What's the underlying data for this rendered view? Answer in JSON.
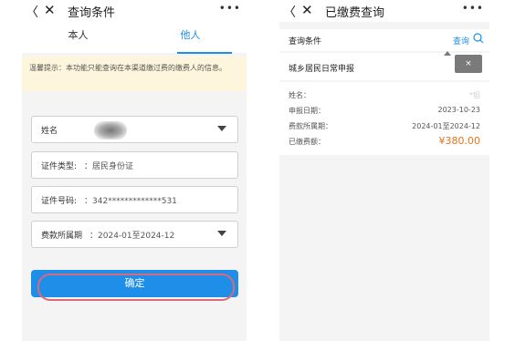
{
  "left": {
    "nav": {
      "back": "〈",
      "close": "✕",
      "title": "查询条件",
      "more": "•••"
    },
    "tabs": [
      {
        "label": "本人",
        "active": false
      },
      {
        "label": "他人",
        "active": true
      }
    ],
    "notice": "温馨提示：本功能只能查询在本渠道缴过费的缴费人的信息。",
    "fields": {
      "name": {
        "label": "姓名"
      },
      "id_type": {
        "label": "证件类型:",
        "value": "：居民身份证"
      },
      "id_number": {
        "label": "证件号码:",
        "value": "：342*************531"
      },
      "period": {
        "label": "费款所属期",
        "value": "：2024-01至2024-12"
      }
    },
    "confirm_label": "确定"
  },
  "right": {
    "nav": {
      "back": "〈",
      "close": "✕",
      "title": "已缴费查询",
      "more": "•••"
    },
    "criteria_label": "查询条件",
    "query_link": "查询",
    "record_type": "城乡居民日常申报",
    "tooltip_close": "×",
    "details": [
      {
        "key": "姓名：",
        "value": "*坦"
      },
      {
        "key": "申报日期：",
        "value": "2023-10-23"
      },
      {
        "key": "费款所属期：",
        "value": "2024-01至2024-12"
      },
      {
        "key": "已缴费额：",
        "value": "¥380.00"
      }
    ]
  },
  "colors": {
    "accent": "#1f8ee8",
    "amount": "#e8741e",
    "highlight_ring": "#d96a7a",
    "notice_bg": "#fdf6dd"
  }
}
